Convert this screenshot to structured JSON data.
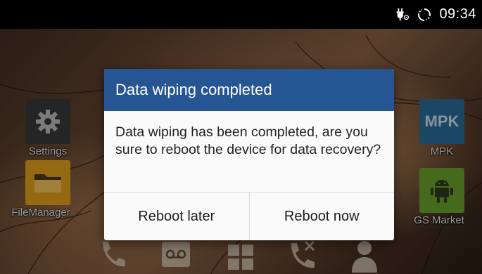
{
  "status_bar": {
    "usb_icon": "usb-debug-icon",
    "sync_icon": "sync-icon",
    "time": "09:34"
  },
  "apps": [
    {
      "name": "settings",
      "label": "Settings",
      "icon": "gear-icon",
      "color": "#3a3a3a"
    },
    {
      "name": "filemanager",
      "label": "FileManager",
      "icon": "folder-icon",
      "color": "#e4a21b"
    },
    {
      "name": "mpk",
      "label": "MPK",
      "icon_text": "MPK",
      "color": "#2b6e9a"
    },
    {
      "name": "gs-market",
      "label": "GS Market",
      "icon": "android-icon",
      "color": "#6aa32a"
    }
  ],
  "dock": [
    "phone-icon",
    "voicemail-icon",
    "grid-icon",
    "call-forward-icon",
    "contacts-icon"
  ],
  "dialog": {
    "title": "Data wiping completed",
    "message": "Data wiping has been completed, are you sure to reboot the device for data recovery?",
    "buttons": {
      "later": "Reboot later",
      "now": "Reboot now"
    },
    "title_color": "#255592"
  }
}
